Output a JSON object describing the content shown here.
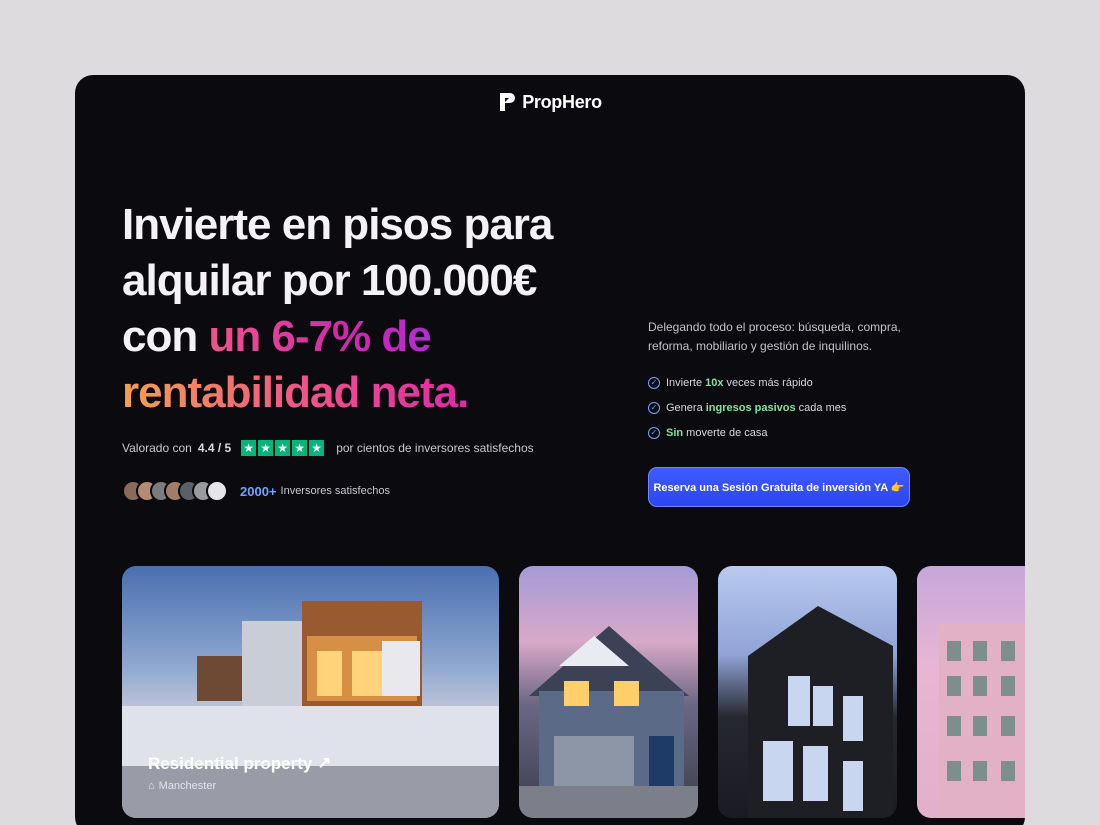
{
  "brand": {
    "name": "PropHero",
    "logo_icon": "prophero-logo-icon"
  },
  "hero": {
    "line1": "Invierte en pisos para",
    "line2": "alquilar por 100.000€",
    "line3_plain": "con ",
    "line3_grad": "un 6-7% de",
    "line4": "rentabilidad neta."
  },
  "rating": {
    "prefix": "Valorado con",
    "score": "4.4 / 5",
    "stars": 5,
    "suffix": "por cientos de inversores satisfechos",
    "star_color": "#00b67a"
  },
  "investors": {
    "count": "2000+",
    "label": "Inversores satisfechos",
    "avatar_count": 7
  },
  "intro": "Delegando todo el proceso: búsqueda, compra, reforma, mobiliario y gestión de inquilinos.",
  "benefits": [
    {
      "pre": "Invierte ",
      "hl": "10x",
      "post": " veces más rápido"
    },
    {
      "pre": "Genera ",
      "hl": "ingresos pasivos",
      "post": " cada mes"
    },
    {
      "pre": "",
      "hl": "Sin",
      "post": " moverte de casa"
    }
  ],
  "cta": {
    "label": "Reserva una Sesión Gratuita de inversión YA 👉"
  },
  "cards": [
    {
      "title": "Residential property ↗",
      "location": "Manchester"
    }
  ],
  "colors": {
    "background": "#0b0a0f",
    "accent_blue": "#2c46f0",
    "highlight_green": "#7fe3a3"
  }
}
